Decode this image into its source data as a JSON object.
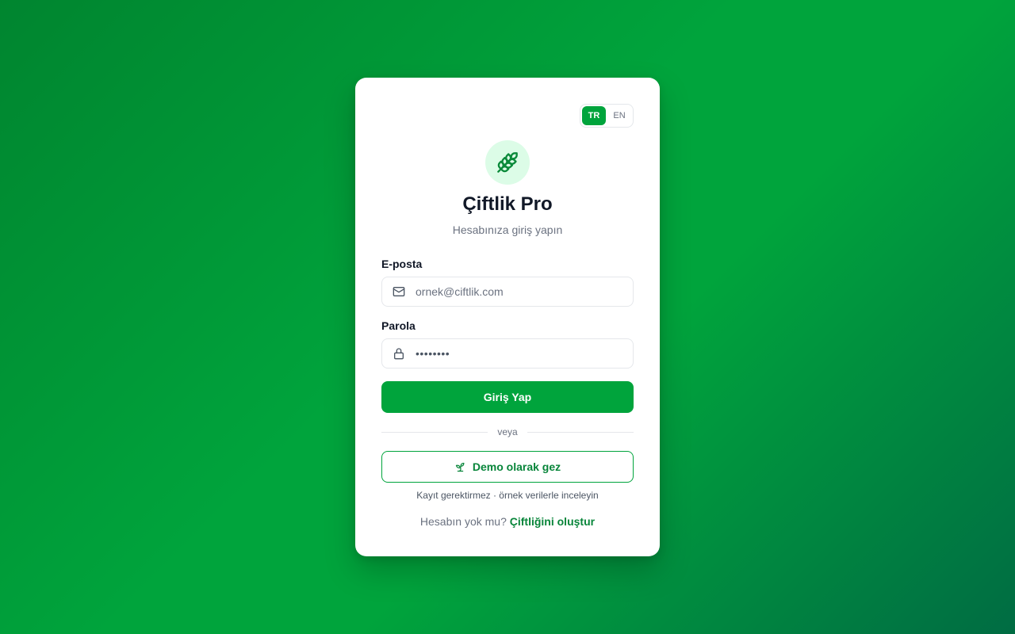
{
  "language_toggle": {
    "options": [
      "TR",
      "EN"
    ],
    "selected": "TR"
  },
  "brand": {
    "name": "Çiftlik Pro",
    "icon": "wheat-icon"
  },
  "subtitle": "Hesabınıza giriş yapın",
  "form": {
    "email": {
      "label": "E-posta",
      "placeholder": "ornek@ciftlik.com",
      "value": "",
      "icon": "mail-icon"
    },
    "password": {
      "label": "Parola",
      "value": "••••••••",
      "icon": "lock-icon"
    },
    "submit_label": "Giriş Yap"
  },
  "divider_label": "veya",
  "demo": {
    "button_label": "Demo olarak gez",
    "icon": "sprout-icon",
    "note": "Kayıt gerektirmez · örnek verilerle inceleyin"
  },
  "signup": {
    "prompt": "Hesabın yok mu?",
    "link_label": "Çiftliğini oluştur"
  },
  "colors": {
    "primary": "#00a43c",
    "primary_dark": "#08853a",
    "logo_bg": "#dcfce7"
  }
}
